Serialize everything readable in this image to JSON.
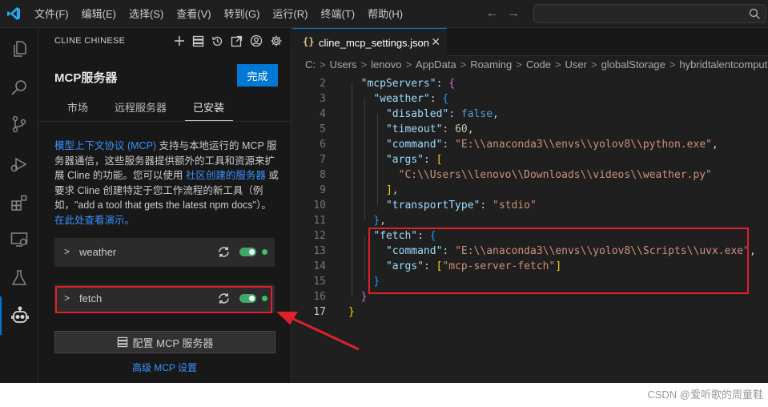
{
  "menu": [
    "文件(F)",
    "编辑(E)",
    "选择(S)",
    "查看(V)",
    "转到(G)",
    "运行(R)",
    "终端(T)",
    "帮助(H)"
  ],
  "sidebar": {
    "header": "CLINE CHINESE",
    "title": "MCP服务器",
    "done_label": "完成",
    "tabs": [
      "市场",
      "远程服务器",
      "已安装"
    ],
    "active_tab": "已安装",
    "desc_parts": [
      {
        "text": "模型上下文协议 (MCP)",
        "link": true
      },
      {
        "text": " 支持与本地运行的 MCP 服务器通信，这些服务器提供额外的工具和资源来扩展 Cline 的功能。您可以使用 ",
        "link": false
      },
      {
        "text": "社区创建的服务器",
        "link": true
      },
      {
        "text": " 或要求 Cline 创建特定于您工作流程的新工具（例如，\"add a tool that gets the latest npm docs\"）。 ",
        "link": false
      },
      {
        "text": "在此处查看演示。",
        "link": true
      }
    ],
    "servers": [
      {
        "name": "weather",
        "enabled": true,
        "status": "connected"
      },
      {
        "name": "fetch",
        "enabled": true,
        "status": "connected"
      }
    ],
    "config_button": "配置 MCP 服务器",
    "advanced_link": "高级 MCP 设置"
  },
  "editor": {
    "tab_name": "cline_mcp_settings.json",
    "breadcrumb": [
      "C:",
      "Users",
      "lenovo",
      "AppData",
      "Roaming",
      "Code",
      "User",
      "globalStorage",
      "hybridtalentcomputing"
    ],
    "lines": [
      {
        "n": "2",
        "tokens": [
          [
            "p",
            "  "
          ],
          [
            "k",
            "\"mcpServers\""
          ],
          [
            "p",
            ": "
          ],
          [
            "br2",
            "{"
          ]
        ]
      },
      {
        "n": "3",
        "tokens": [
          [
            "p",
            "    "
          ],
          [
            "k",
            "\"weather\""
          ],
          [
            "p",
            ": "
          ],
          [
            "br3",
            "{"
          ]
        ]
      },
      {
        "n": "4",
        "tokens": [
          [
            "p",
            "      "
          ],
          [
            "k",
            "\"disabled\""
          ],
          [
            "p",
            ": "
          ],
          [
            "b",
            "false"
          ],
          [
            "p",
            ","
          ]
        ]
      },
      {
        "n": "5",
        "tokens": [
          [
            "p",
            "      "
          ],
          [
            "k",
            "\"timeout\""
          ],
          [
            "p",
            ": "
          ],
          [
            "n",
            "60"
          ],
          [
            "p",
            ","
          ]
        ]
      },
      {
        "n": "6",
        "tokens": [
          [
            "p",
            "      "
          ],
          [
            "k",
            "\"command\""
          ],
          [
            "p",
            ": "
          ],
          [
            "s",
            "\"E:\\\\anaconda3\\\\envs\\\\yolov8\\\\python.exe\""
          ],
          [
            "p",
            ","
          ]
        ]
      },
      {
        "n": "7",
        "tokens": [
          [
            "p",
            "      "
          ],
          [
            "k",
            "\"args\""
          ],
          [
            "p",
            ": "
          ],
          [
            "br1",
            "["
          ]
        ]
      },
      {
        "n": "8",
        "tokens": [
          [
            "p",
            "        "
          ],
          [
            "s",
            "\"C:\\\\Users\\\\lenovo\\\\Downloads\\\\videos\\\\weather.py\""
          ]
        ]
      },
      {
        "n": "9",
        "tokens": [
          [
            "p",
            "      "
          ],
          [
            "br1",
            "]"
          ],
          [
            "p",
            ","
          ]
        ]
      },
      {
        "n": "10",
        "tokens": [
          [
            "p",
            "      "
          ],
          [
            "k",
            "\"transportType\""
          ],
          [
            "p",
            ": "
          ],
          [
            "s",
            "\"stdio\""
          ]
        ]
      },
      {
        "n": "11",
        "tokens": [
          [
            "p",
            "    "
          ],
          [
            "br3",
            "}"
          ],
          [
            "p",
            ","
          ]
        ]
      },
      {
        "n": "12",
        "tokens": [
          [
            "p",
            "    "
          ],
          [
            "k",
            "\"fetch\""
          ],
          [
            "p",
            ": "
          ],
          [
            "br3",
            "{"
          ]
        ]
      },
      {
        "n": "13",
        "tokens": [
          [
            "p",
            "      "
          ],
          [
            "k",
            "\"command\""
          ],
          [
            "p",
            ": "
          ],
          [
            "s",
            "\"E:\\\\anaconda3\\\\envs\\\\yolov8\\\\Scripts\\\\uvx.exe\""
          ],
          [
            "p",
            ","
          ]
        ]
      },
      {
        "n": "14",
        "tokens": [
          [
            "p",
            "      "
          ],
          [
            "k",
            "\"args\""
          ],
          [
            "p",
            ": "
          ],
          [
            "br1",
            "["
          ],
          [
            "s",
            "\"mcp-server-fetch\""
          ],
          [
            "br1",
            "]"
          ]
        ]
      },
      {
        "n": "15",
        "tokens": [
          [
            "p",
            "    "
          ],
          [
            "br3",
            "}"
          ]
        ]
      },
      {
        "n": "16",
        "tokens": [
          [
            "p",
            "  "
          ],
          [
            "br2",
            "}"
          ]
        ]
      },
      {
        "n": "17",
        "tokens": [
          [
            "br1",
            "}"
          ]
        ]
      }
    ],
    "current_line": "17"
  },
  "watermark": "CSDN @爱听歌的周童鞋",
  "colors": {
    "accent": "#0078d4",
    "highlight": "#e0202a",
    "toggle_on": "#3fa86a"
  }
}
